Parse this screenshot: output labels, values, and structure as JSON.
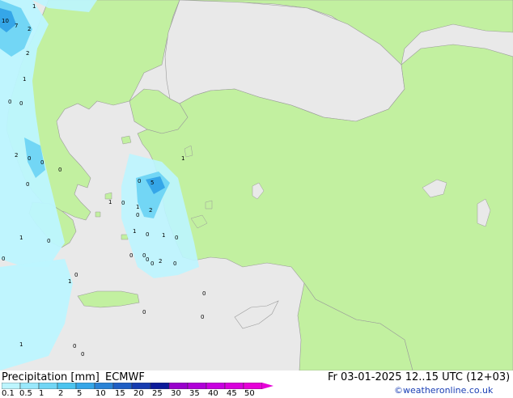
{
  "footer": {
    "product": "Precipitation [mm]",
    "model": "ECMWF",
    "valid_time": "Fr 03-01-2025 12..15 UTC (12+03)",
    "copyright": "©weatheronline.co.uk"
  },
  "legend": {
    "ticks": [
      "0.1",
      "0.5",
      "1",
      "2",
      "5",
      "10",
      "15",
      "20",
      "25",
      "30",
      "35",
      "40",
      "45",
      "50"
    ],
    "colors": [
      "#bdf5ff",
      "#99e8fb",
      "#72d6f5",
      "#4cc4ef",
      "#35a6e8",
      "#2a83d6",
      "#1f5ec4",
      "#163cb0",
      "#0c1a9a",
      "#9900cc",
      "#b000d8",
      "#c800e0",
      "#d800dc",
      "#e600d8"
    ]
  },
  "map": {
    "land_color": "#c2f0a0",
    "outside_land_color": "#e9e9e9",
    "sea_color": "#e9e9e9",
    "precip_light_color": "#bdf5ff",
    "precip_medium_color": "#72d6f5",
    "precip_heavy_color": "#35a6e8",
    "values": [
      "10",
      "7",
      "2",
      "1",
      "2",
      "1",
      "0",
      "0",
      "2",
      "0",
      "0",
      "0",
      "0",
      "1",
      "1",
      "0",
      "5",
      "0",
      "1",
      "2",
      "0",
      "1",
      "1",
      "0",
      "0",
      "0",
      "0",
      "0",
      "0",
      "2",
      "0",
      "0",
      "1",
      "1",
      "0",
      "0",
      "0",
      "0",
      "0",
      "1",
      "0",
      "0"
    ]
  }
}
